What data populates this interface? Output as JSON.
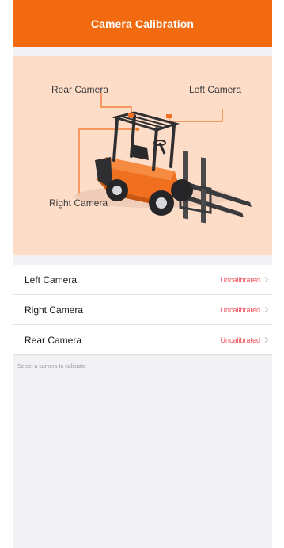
{
  "header": {
    "title": "Camera Calibration"
  },
  "hero": {
    "labels": {
      "rear": "Rear Camera",
      "left": "Left Camera",
      "right": "Right Camera"
    },
    "colors": {
      "background": "#fddcc8",
      "forklift_body": "#f07020",
      "leader_line": "#f07020"
    }
  },
  "cameras": [
    {
      "label": "Left Camera",
      "status": "Uncalibrated"
    },
    {
      "label": "Right Camera",
      "status": "Uncalibrated"
    },
    {
      "label": "Rear Camera",
      "status": "Uncalibrated"
    }
  ],
  "hint": "Select a camera to calibrate",
  "theme": {
    "accent": "#f26a0f",
    "status_color": "#f0505a"
  }
}
